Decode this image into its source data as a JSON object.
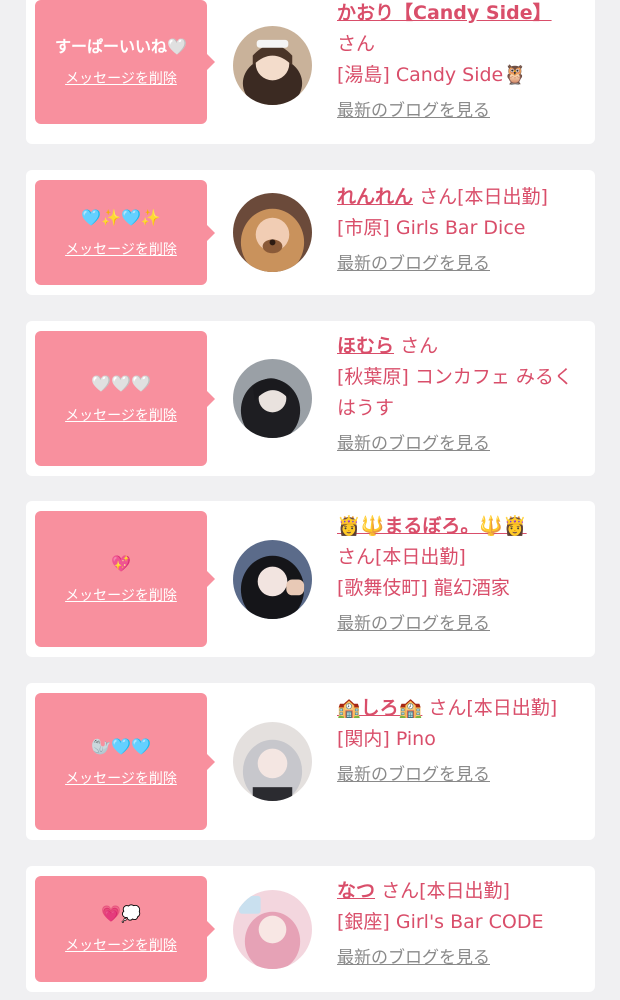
{
  "delete_label": "メッセージを削除",
  "blog_label": "最新のブログを見る",
  "colors": {
    "bubble": "#f8909e",
    "accent": "#d94e6a",
    "muted": "#8a8a8a"
  },
  "cards": [
    {
      "message": "すーぱーいいね🤍",
      "name": "かおり【Candy Side】",
      "suffix": "さん",
      "shop": "[湯島] Candy Side🦉"
    },
    {
      "message": "🩵✨🩵✨",
      "name": "れんれん",
      "suffix": "さん[本日出勤]",
      "shop": "[市原] Girls Bar Dice"
    },
    {
      "message": "🤍🤍🤍",
      "name": "ほむら",
      "suffix": "さん",
      "shop": "[秋葉原] コンカフェ みるくはうす"
    },
    {
      "message": "💖",
      "name": "👸🔱まるぼろ。🔱👸",
      "suffix": "さん[本日出勤]",
      "shop": "[歌舞伎町] 龍幻酒家"
    },
    {
      "message": "🦭🩵🩵",
      "name": "🏫しろ🏫",
      "suffix": "さん[本日出勤]",
      "shop": "[関内] Pino"
    },
    {
      "message": "💗💭",
      "name": "なつ",
      "suffix": "さん[本日出勤]",
      "shop": "[銀座] Girl's Bar CODE"
    }
  ]
}
